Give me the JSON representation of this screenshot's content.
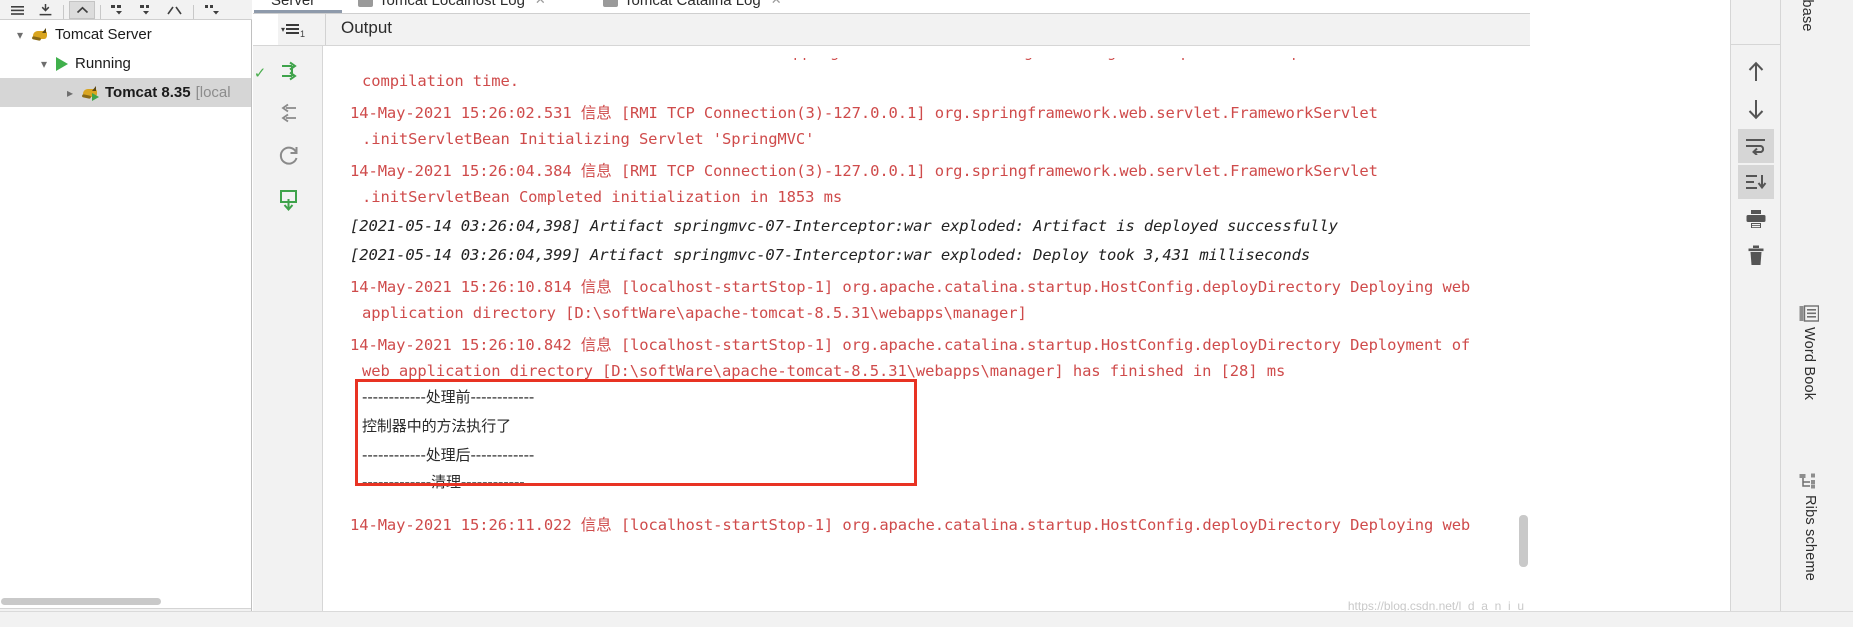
{
  "window": {
    "left_toolbar_icons": [
      "menu-icon",
      "download-icon",
      "collapse-up-icon",
      "expand-branch-icon",
      "collapse-branch-icon",
      "jump-icon",
      "settings-icon"
    ],
    "tree": {
      "root_label": "Tomcat Server",
      "root_icon": "tomcat-cat-icon",
      "group_label": "Running",
      "group_icon": "run-play-icon",
      "server_label": "Tomcat 8.35",
      "server_suffix": "[local",
      "server_icon": "tomcat-cat-running-icon"
    }
  },
  "tabs": [
    {
      "label": "Server",
      "icon": "",
      "active": true,
      "closable": false
    },
    {
      "label": "Tomcat Localhost Log",
      "icon": "log-file-icon",
      "active": false,
      "closable": true
    },
    {
      "label": "Tomcat Catalina Log",
      "icon": "log-file-icon",
      "active": false,
      "closable": true
    }
  ],
  "output_bar": {
    "title": "Output",
    "fold_badge": "1"
  },
  "gutter_icons": [
    "rerun-icon",
    "scroll-to-end-icon",
    "restart-icon",
    "export-icon"
  ],
  "console": {
    "lines": [
      {
        "text": "were scanned but no TLDs were found in them. Skipping unneeded JARs during scanning can improve startup time and JSP",
        "style": "red",
        "indent": 0,
        "clipped_top": true
      },
      {
        "text": "compilation time.",
        "style": "red",
        "indent": 1
      },
      {
        "text": "14-May-2021 15:26:02.531 信息 [RMI TCP Connection(3)-127.0.0.1] org.springframework.web.servlet.FrameworkServlet",
        "style": "red",
        "indent": 0
      },
      {
        "text": ".initServletBean Initializing Servlet 'SpringMVC'",
        "style": "red",
        "indent": 1
      },
      {
        "text": "14-May-2021 15:26:04.384 信息 [RMI TCP Connection(3)-127.0.0.1] org.springframework.web.servlet.FrameworkServlet",
        "style": "red",
        "indent": 0
      },
      {
        "text": ".initServletBean Completed initialization in 1853 ms",
        "style": "red",
        "indent": 1
      },
      {
        "text": "[2021-05-14 03:26:04,398] Artifact springmvc-07-Interceptor:war exploded: Artifact is deployed successfully",
        "style": "dark",
        "indent": 0
      },
      {
        "text": "[2021-05-14 03:26:04,399] Artifact springmvc-07-Interceptor:war exploded: Deploy took 3,431 milliseconds",
        "style": "dark",
        "indent": 0
      },
      {
        "text": "14-May-2021 15:26:10.814 信息 [localhost-startStop-1] org.apache.catalina.startup.HostConfig.deployDirectory Deploying web",
        "style": "red",
        "indent": 0
      },
      {
        "text": "application directory [D:\\softWare\\apache-tomcat-8.5.31\\webapps\\manager]",
        "style": "red",
        "indent": 1
      },
      {
        "text": "14-May-2021 15:26:10.842 信息 [localhost-startStop-1] org.apache.catalina.startup.HostConfig.deployDirectory Deployment of",
        "style": "red",
        "indent": 0
      },
      {
        "text": "web application directory [D:\\softWare\\apache-tomcat-8.5.31\\webapps\\manager] has finished in [28] ms",
        "style": "red",
        "indent": 1
      },
      {
        "text": "------------处理前------------",
        "style": "cn",
        "indent": 0
      },
      {
        "text": "控制器中的方法执行了",
        "style": "cn",
        "indent": 0
      },
      {
        "text": "------------处理后------------",
        "style": "cn",
        "indent": 0
      },
      {
        "text": "-------------清理------------",
        "style": "cn",
        "indent": 0
      },
      {
        "text": "14-May-2021 15:26:11.022 信息 [localhost-startStop-1] org.apache.catalina.startup.HostConfig.deployDirectory Deploying web",
        "style": "red",
        "indent": 0,
        "clipped_bottom": true
      }
    ],
    "highlight_box_color": "#e83323",
    "watermark": "https://blog.csdn.net/l_d_a_n_i_u"
  },
  "right_toolbar": {
    "buttons": [
      {
        "name": "scroll-up-icon",
        "active": false
      },
      {
        "name": "scroll-down-icon",
        "active": false
      },
      {
        "name": "soft-wrap-icon",
        "active": true
      },
      {
        "name": "scroll-to-end-icon",
        "active": true
      },
      {
        "name": "print-icon",
        "active": false
      },
      {
        "name": "clear-all-icon",
        "active": false
      }
    ]
  },
  "far_right_tools": [
    {
      "label": "Database",
      "icon": "database-icon"
    },
    {
      "label": "Word Book",
      "icon": "wordbook-icon"
    },
    {
      "label": "Ribs scheme",
      "icon": "ribs-scheme-icon"
    }
  ]
}
